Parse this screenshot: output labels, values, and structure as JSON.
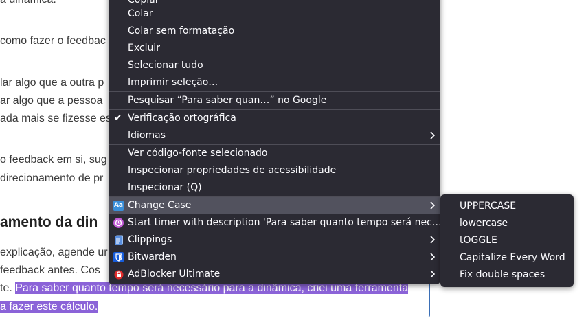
{
  "document": {
    "lines": [
      "a dinâmica.",
      "como fazer o feedbac",
      "lar algo que a outra p",
      "ar algo que a pessoa",
      "ada mais se fizesse es",
      "o feedback em si, sug",
      "direcionamento de pr"
    ],
    "heading": "amento da din",
    "editor_line1": "explicação, agende ur",
    "editor_line2": " feedback antes. Cos",
    "editor_line3_prefix": "te. ",
    "editor_line3_selected": "Para saber quanto tempo será necessário para a dinâmica, criei uma ferramenta",
    "editor_line4_selected": "a fazer este cálculo."
  },
  "context_menu": {
    "items": [
      {
        "label": "Copiar"
      },
      {
        "label": "Colar"
      },
      {
        "label": "Colar sem formatação"
      },
      {
        "label": "Excluir"
      },
      {
        "label": "Selecionar tudo"
      },
      {
        "label": "Imprimir seleção…"
      },
      {
        "label": "Pesquisar “Para saber quan…” no Google"
      },
      {
        "label": "Verificação ortográfica",
        "checked": true
      },
      {
        "label": "Idiomas"
      },
      {
        "label": "Ver código-fonte selecionado"
      },
      {
        "label": "Inspecionar propriedades de acessibilidade"
      },
      {
        "label": "Inspecionar (Q)"
      },
      {
        "label": "Change Case",
        "icon": "change-case-icon"
      },
      {
        "label": "Start timer with description 'Para saber quanto tempo será nec…'",
        "icon": "timer-icon"
      },
      {
        "label": "Clippings",
        "icon": "clippings-icon"
      },
      {
        "label": "Bitwarden",
        "icon": "bitwarden-icon"
      },
      {
        "label": "AdBlocker Ultimate",
        "icon": "adblocker-icon"
      }
    ]
  },
  "change_case_submenu": {
    "items": [
      {
        "label": "UPPERCASE"
      },
      {
        "label": "lowercase"
      },
      {
        "label": "tOGGLE"
      },
      {
        "label": "Capitalize Every Word"
      },
      {
        "label": "Fix double spaces"
      }
    ]
  },
  "colors": {
    "menu_bg": "#2b2a33",
    "menu_highlight": "#52525e",
    "selection": "#8b63d8",
    "editor_border": "#3b6fb6"
  }
}
